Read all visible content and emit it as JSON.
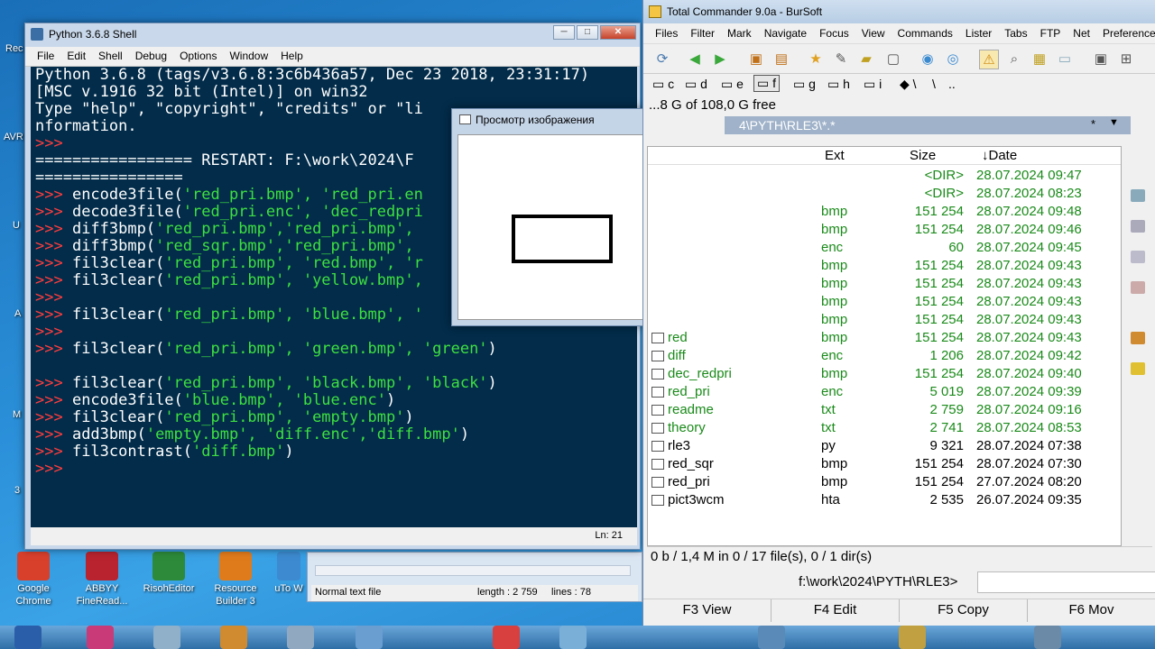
{
  "desktop": {
    "left_labels": [
      "Rec",
      "AVR",
      "U",
      "A",
      "M",
      "3"
    ],
    "bottom_icons": [
      {
        "label": "Google Chrome",
        "color": "#d8402c"
      },
      {
        "label": "ABBYY FineRead...",
        "color": "#b8232f"
      },
      {
        "label": "RisohEditor",
        "color": "#2d8a3a"
      },
      {
        "label": "Resource Builder 3",
        "color": "#e07b1c"
      },
      {
        "label": "uTo W",
        "color": "#3d8ad0"
      }
    ]
  },
  "python_shell": {
    "title": "Python 3.6.8 Shell",
    "menu": [
      "File",
      "Edit",
      "Shell",
      "Debug",
      "Options",
      "Window",
      "Help"
    ],
    "status": "Ln: 21",
    "lines": [
      {
        "plain": "Python 3.6.8 (tags/v3.6.8:3c6b436a57, Dec 23 2018, 23:31:17)"
      },
      {
        "plain": "[MSC v.1916 32 bit (Intel)] on win32"
      },
      {
        "plain": "Type \"help\", \"copyright\", \"credits\" or \"li"
      },
      {
        "plain": "nformation."
      },
      {
        "prompt": ">>>",
        "plain": ""
      },
      {
        "plain": "================= RESTART: F:\\work\\2024\\F"
      },
      {
        "plain": "================"
      },
      {
        "prompt": ">>>",
        "plain": " encode3file(",
        "str": "'red_pri.bmp', 'red_pri.en"
      },
      {
        "prompt": ">>>",
        "plain": " decode3file(",
        "str": "'red_pri.enc', 'dec_redpri"
      },
      {
        "prompt": ">>>",
        "plain": " diff3bmp(",
        "str": "'red_pri.bmp','red_pri.bmp',"
      },
      {
        "prompt": ">>>",
        "plain": " diff3bmp(",
        "str": "'red_sqr.bmp','red_pri.bmp',"
      },
      {
        "prompt": ">>>",
        "plain": " fil3clear(",
        "str": "'red_pri.bmp', 'red.bmp', 'r"
      },
      {
        "prompt": ">>>",
        "plain": " fil3clear(",
        "str": "'red_pri.bmp', 'yellow.bmp',"
      },
      {
        "prompt": ">>>",
        "plain": ""
      },
      {
        "prompt": ">>>",
        "plain": " fil3clear(",
        "str": "'red_pri.bmp', 'blue.bmp', '"
      },
      {
        "prompt": ">>>",
        "plain": ""
      },
      {
        "prompt": ">>>",
        "plain": " fil3clear(",
        "str": "'red_pri.bmp', 'green.bmp', 'green'",
        "tail": ")"
      },
      {
        "plain": ""
      },
      {
        "prompt": ">>>",
        "plain": " fil3clear(",
        "str": "'red_pri.bmp', 'black.bmp', 'black'",
        "tail": ")"
      },
      {
        "prompt": ">>>",
        "plain": " encode3file(",
        "str": "'blue.bmp', 'blue.enc'",
        "tail": ")"
      },
      {
        "prompt": ">>>",
        "plain": " fil3clear(",
        "str": "'red_pri.bmp', 'empty.bmp'",
        "tail": ")"
      },
      {
        "prompt": ">>>",
        "plain": " add3bmp(",
        "str": "'empty.bmp', 'diff.enc','diff.bmp'",
        "tail": ")"
      },
      {
        "prompt": ">>>",
        "plain": " fil3contrast(",
        "str": "'diff.bmp'",
        "tail": ")"
      },
      {
        "prompt": ">>>",
        "plain": ""
      }
    ]
  },
  "image_viewer": {
    "title": "Просмотр изображения"
  },
  "background_window": {
    "status_left": "Normal text file",
    "length": "length : 2 759",
    "lines": "lines : 78"
  },
  "total_commander": {
    "title": "Total Commander 9.0a - BurSoft",
    "menu": [
      "Files",
      "Filter",
      "Mark",
      "Navigate",
      "Focus",
      "View",
      "Commands",
      "Lister",
      "Tabs",
      "FTP",
      "Net",
      "Preferences"
    ],
    "drives": [
      "c",
      "d",
      "e",
      "f",
      "g",
      "h",
      "i",
      "\\",
      "\\",
      ".."
    ],
    "free_space": "...8 G of 108,0 G free",
    "path": "4\\PYTH\\RLE3\\*.*",
    "columns": {
      "ext": "Ext",
      "size": "Size",
      "date": "Date"
    },
    "files": [
      {
        "name": "",
        "ext": "",
        "size": "<DIR>",
        "date": "28.07.2024 09:47",
        "color": "green"
      },
      {
        "name": "",
        "ext": "",
        "size": "<DIR>",
        "date": "28.07.2024 08:23",
        "color": "green"
      },
      {
        "name": "",
        "ext": "bmp",
        "size": "151 254",
        "date": "28.07.2024 09:48",
        "color": "green"
      },
      {
        "name": "",
        "ext": "bmp",
        "size": "151 254",
        "date": "28.07.2024 09:46",
        "color": "green"
      },
      {
        "name": "",
        "ext": "enc",
        "size": "60",
        "date": "28.07.2024 09:45",
        "color": "green"
      },
      {
        "name": "",
        "ext": "bmp",
        "size": "151 254",
        "date": "28.07.2024 09:43",
        "color": "green"
      },
      {
        "name": "",
        "ext": "bmp",
        "size": "151 254",
        "date": "28.07.2024 09:43",
        "color": "green"
      },
      {
        "name": "",
        "ext": "bmp",
        "size": "151 254",
        "date": "28.07.2024 09:43",
        "color": "green"
      },
      {
        "name": "",
        "ext": "bmp",
        "size": "151 254",
        "date": "28.07.2024 09:43",
        "color": "green"
      },
      {
        "name": "red",
        "ext": "bmp",
        "size": "151 254",
        "date": "28.07.2024 09:43",
        "color": "green"
      },
      {
        "name": "diff",
        "ext": "enc",
        "size": "1 206",
        "date": "28.07.2024 09:42",
        "color": "green"
      },
      {
        "name": "dec_redpri",
        "ext": "bmp",
        "size": "151 254",
        "date": "28.07.2024 09:40",
        "color": "green"
      },
      {
        "name": "red_pri",
        "ext": "enc",
        "size": "5 019",
        "date": "28.07.2024 09:39",
        "color": "green"
      },
      {
        "name": "readme",
        "ext": "txt",
        "size": "2 759",
        "date": "28.07.2024 09:16",
        "color": "green"
      },
      {
        "name": "theory",
        "ext": "txt",
        "size": "2 741",
        "date": "28.07.2024 08:53",
        "color": "green"
      },
      {
        "name": "rle3",
        "ext": "py",
        "size": "9 321",
        "date": "28.07.2024 07:38",
        "color": "black"
      },
      {
        "name": "red_sqr",
        "ext": "bmp",
        "size": "151 254",
        "date": "28.07.2024 07:30",
        "color": "black"
      },
      {
        "name": "red_pri",
        "ext": "bmp",
        "size": "151 254",
        "date": "27.07.2024 08:20",
        "color": "black"
      },
      {
        "name": "pict3wcm",
        "ext": "hta",
        "size": "2 535",
        "date": "26.07.2024 09:35",
        "color": "black"
      }
    ],
    "status": "0 b / 1,4 M in 0 / 17 file(s), 0 / 1 dir(s)",
    "cmd_path": "f:\\work\\2024\\PYTH\\RLE3>",
    "fkeys": [
      "F3 View",
      "F4 Edit",
      "F5 Copy",
      "F6 Mov"
    ]
  }
}
